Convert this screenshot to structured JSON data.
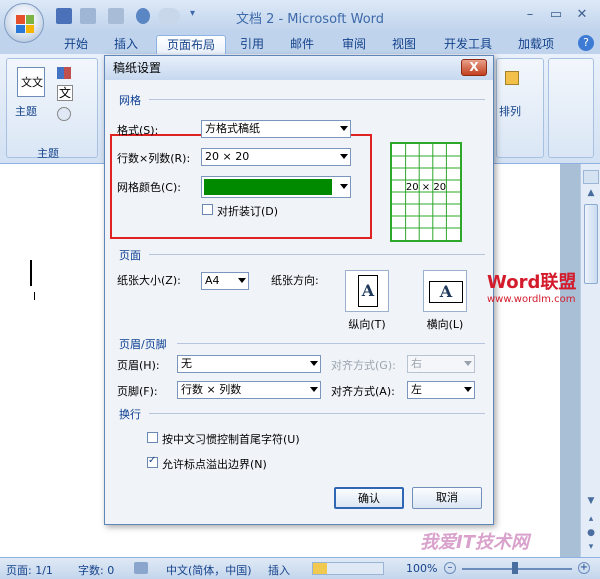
{
  "window": {
    "title": "文档 2 - Microsoft Word",
    "minimize": "–",
    "maximize": "▭",
    "close": "✕"
  },
  "tabs": [
    "开始",
    "插入",
    "页面布局",
    "引用",
    "邮件",
    "审阅",
    "视图",
    "开发工具",
    "加载项"
  ],
  "ribbon": {
    "theme_label": "主题",
    "theme_group": "主题",
    "wen_label": "文",
    "arrange_label": "排列"
  },
  "dialog": {
    "title": "稿纸设置",
    "close": "X",
    "grid_section": "网格",
    "format_label": "格式(S):",
    "format_value": "方格式稿纸",
    "rows_cols_label": "行数×列数(R):",
    "rows_cols_value": "20 × 20",
    "grid_color_label": "网格颜色(C):",
    "grid_color_hex": "#008a00",
    "fold_bind_label": "对折装订(D)",
    "preview_text": "20 × 20",
    "page_section": "页面",
    "paper_size_label": "纸张大小(Z):",
    "paper_size_value": "A4",
    "orientation_label": "纸张方向:",
    "portrait_label": "纵向(T)",
    "landscape_label": "横向(L)",
    "orient_glyph": "A",
    "header_footer_section": "页眉/页脚",
    "header_label": "页眉(H):",
    "header_value": "无",
    "header_align_label": "对齐方式(G):",
    "header_align_value": "右",
    "footer_label": "页脚(F):",
    "footer_value": "行数 × 列数",
    "footer_align_label": "对齐方式(A):",
    "footer_align_value": "左",
    "wrap_section": "换行",
    "option1_label": "按中文习惯控制首尾字符(U)",
    "option1_checked": false,
    "option2_label": "允许标点溢出边界(N)",
    "option2_checked": true,
    "ok_label": "确认",
    "cancel_label": "取消"
  },
  "watermark": {
    "brand": "Word联盟",
    "url": "www.wordlm.com",
    "bottom": "我爱IT技术网"
  },
  "status": {
    "page": "页面: 1/1",
    "words": "字数: 0",
    "language": "中文(简体，中国)",
    "mode": "插入",
    "zoom": "100%"
  }
}
